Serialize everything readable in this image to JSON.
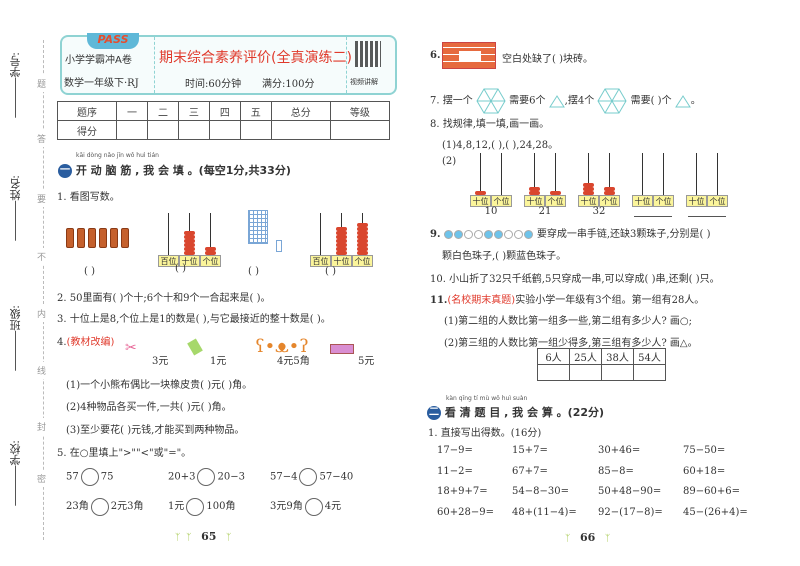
{
  "margin": {
    "binding_chars": [
      "题",
      "答",
      "要",
      "不",
      "内",
      "线",
      "封",
      "密"
    ],
    "fields": [
      "学号:",
      "姓名:",
      "班级:",
      "学校:"
    ]
  },
  "header": {
    "logo": "PASS",
    "series": "小学学霸冲A卷",
    "grade": "数学一年级下·RJ",
    "title": "期末综合素养评价(全真演练二)",
    "time": "时间:60分钟",
    "full_score": "满分:100分",
    "video": "视频讲解"
  },
  "score_table": {
    "headers": [
      "题序",
      "一",
      "二",
      "三",
      "四",
      "五",
      "总分",
      "等级"
    ],
    "row_label": "得分"
  },
  "section1": {
    "num": "一",
    "pinyin": "kāi dòng nǎo jīn   wǒ huì tián",
    "title": "开 动 脑 筋 , 我 会 填 。",
    "points": "(每空1分,共33分)"
  },
  "q1": {
    "text": "1. 看图写数。",
    "blank": "(      )",
    "abacus1": {
      "places": [
        "百位",
        "十位",
        "个位"
      ],
      "beads": [
        0,
        6,
        2
      ]
    },
    "abacus2": {
      "places": [
        "百位",
        "十位",
        "个位"
      ],
      "beads": [
        0,
        7,
        8
      ]
    }
  },
  "q2": "2. 50里面有(      )个十;6个十和9个一合起来是(      )。",
  "q3": "3. 十位上是8,个位上是1的数是(      ),与它最接近的整十数是(      )。",
  "q4": {
    "num": "4.",
    "tag": "(教材改编)",
    "items": [
      {
        "icon": "scissors-icon",
        "price": "3元"
      },
      {
        "icon": "eraser-icon",
        "price": "1元"
      },
      {
        "icon": "teddy-bear-icon",
        "price": "4元5角"
      },
      {
        "icon": "pencil-case-icon",
        "price": "5元"
      }
    ],
    "subs": [
      "(1)一个小熊布偶比一块橡皮贵(      )元(      )角。",
      "(2)4种物品各买一件,一共(      )元(      )角。",
      "(3)至少要花(      )元钱,才能买到两种物品。"
    ]
  },
  "q5": {
    "text": "5. 在○里填上\">\"\"<\"或\"=\"。",
    "rows": [
      [
        [
          "57",
          "75"
        ],
        [
          "20+3",
          "20−3"
        ],
        [
          "57−4",
          "57−40"
        ]
      ],
      [
        [
          "23角",
          "2元3角"
        ],
        [
          "1元",
          "100角"
        ],
        [
          "3元9角",
          "4元"
        ]
      ]
    ]
  },
  "page_left": "65",
  "q6": {
    "num": "6.",
    "text": "空白处缺了(      )块砖。"
  },
  "q7": {
    "a": "7. 摆一个",
    "b": "需要6个",
    "c": ",摆4个",
    "d": "需要(      )个",
    "e": "。"
  },
  "q8": {
    "text": "8. 找规律,填一填,画一画。",
    "sub1": "(1)4,8,12,(      ),(      ),24,28。",
    "sub2": "(2)",
    "places": [
      "十位",
      "个位"
    ],
    "abaci": [
      {
        "tens": 1,
        "ones": 0,
        "label": "10"
      },
      {
        "tens": 2,
        "ones": 1,
        "label": "21"
      },
      {
        "tens": 3,
        "ones": 2,
        "label": "32"
      },
      {
        "tens": 0,
        "ones": 0,
        "label": ""
      },
      {
        "tens": 0,
        "ones": 0,
        "label": ""
      }
    ]
  },
  "q9": {
    "num": "9.",
    "beads": [
      "blue",
      "blue",
      "white",
      "white",
      "blue",
      "blue",
      "white",
      "white",
      "blue"
    ],
    "text": "要穿成一串手链,还缺3颗珠子,分别是(      )",
    "text2": "颗白色珠子,(      )颗蓝色珠子。",
    "colors": {
      "blue": "#6ec3ea",
      "white": "#ffffff"
    }
  },
  "q10": "10. 小山折了32只千纸鹤,5只穿成一串,可以穿成(      )串,还剩(      )只。",
  "q11": {
    "num": "11.",
    "tag": "(名校期末真题)",
    "text": "实验小学一年级有3个组。第一组有28人。",
    "subs": [
      "(1)第二组的人数比第一组多一些,第二组有多少人? 画○;",
      "(2)第三组的人数比第一组少得多,第三组有多少人? 画△。"
    ],
    "options": [
      "6人",
      "25人",
      "38人",
      "54人"
    ]
  },
  "section2": {
    "num": "二",
    "pinyin": "kàn qīng tí mù   wǒ huì suàn",
    "title": "看 清 题 目 , 我 会 算 。",
    "points": "(22分)"
  },
  "calc": {
    "text": "1. 直接写出得数。(16分)",
    "rows": [
      [
        "17−9=",
        "15+7=",
        "30+46=",
        "75−50="
      ],
      [
        "11−2=",
        "67+7=",
        "85−8=",
        "60+18="
      ],
      [
        "18+9+7=",
        "54−8−30=",
        "50+48−90=",
        "89−60+6="
      ],
      [
        "60+28−9=",
        "48+(11−4)=",
        "92−(17−8)=",
        "45−(26+4)="
      ]
    ]
  },
  "page_right": "66"
}
